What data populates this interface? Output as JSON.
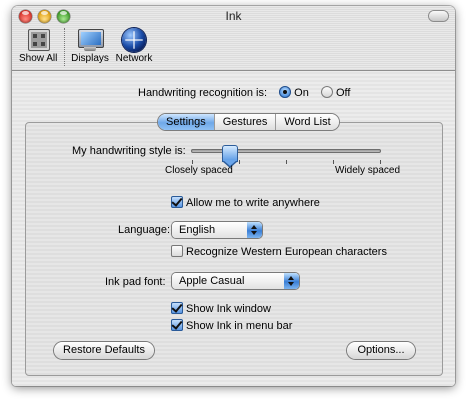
{
  "window": {
    "title": "Ink"
  },
  "toolbar": {
    "show_all": {
      "label": "Show All",
      "icon": "show-all-icon"
    },
    "displays": {
      "label": "Displays",
      "icon": "display-icon"
    },
    "network": {
      "label": "Network",
      "icon": "network-globe-icon"
    }
  },
  "recognition": {
    "label": "Handwriting recognition is:",
    "on_label": "On",
    "off_label": "Off",
    "selected": "On"
  },
  "tabs": [
    {
      "label": "Settings",
      "selected": true
    },
    {
      "label": "Gestures",
      "selected": false
    },
    {
      "label": "Word List",
      "selected": false
    }
  ],
  "settings": {
    "style_label": "My handwriting style is:",
    "slider_min_label": "Closely spaced",
    "slider_max_label": "Widely spaced",
    "slider_value": 0.2,
    "write_anywhere_label": "Allow me to write anywhere",
    "write_anywhere_checked": true,
    "language_label": "Language:",
    "language_value": "English",
    "western_european_label": "Recognize Western European characters",
    "western_european_checked": false,
    "font_label": "Ink pad font:",
    "font_value": "Apple Casual",
    "show_window_label": "Show Ink window",
    "show_window_checked": true,
    "show_menubar_label": "Show Ink in menu bar",
    "show_menubar_checked": true,
    "restore_label": "Restore Defaults",
    "options_label": "Options..."
  },
  "colors": {
    "accent": "#3b83d9"
  }
}
